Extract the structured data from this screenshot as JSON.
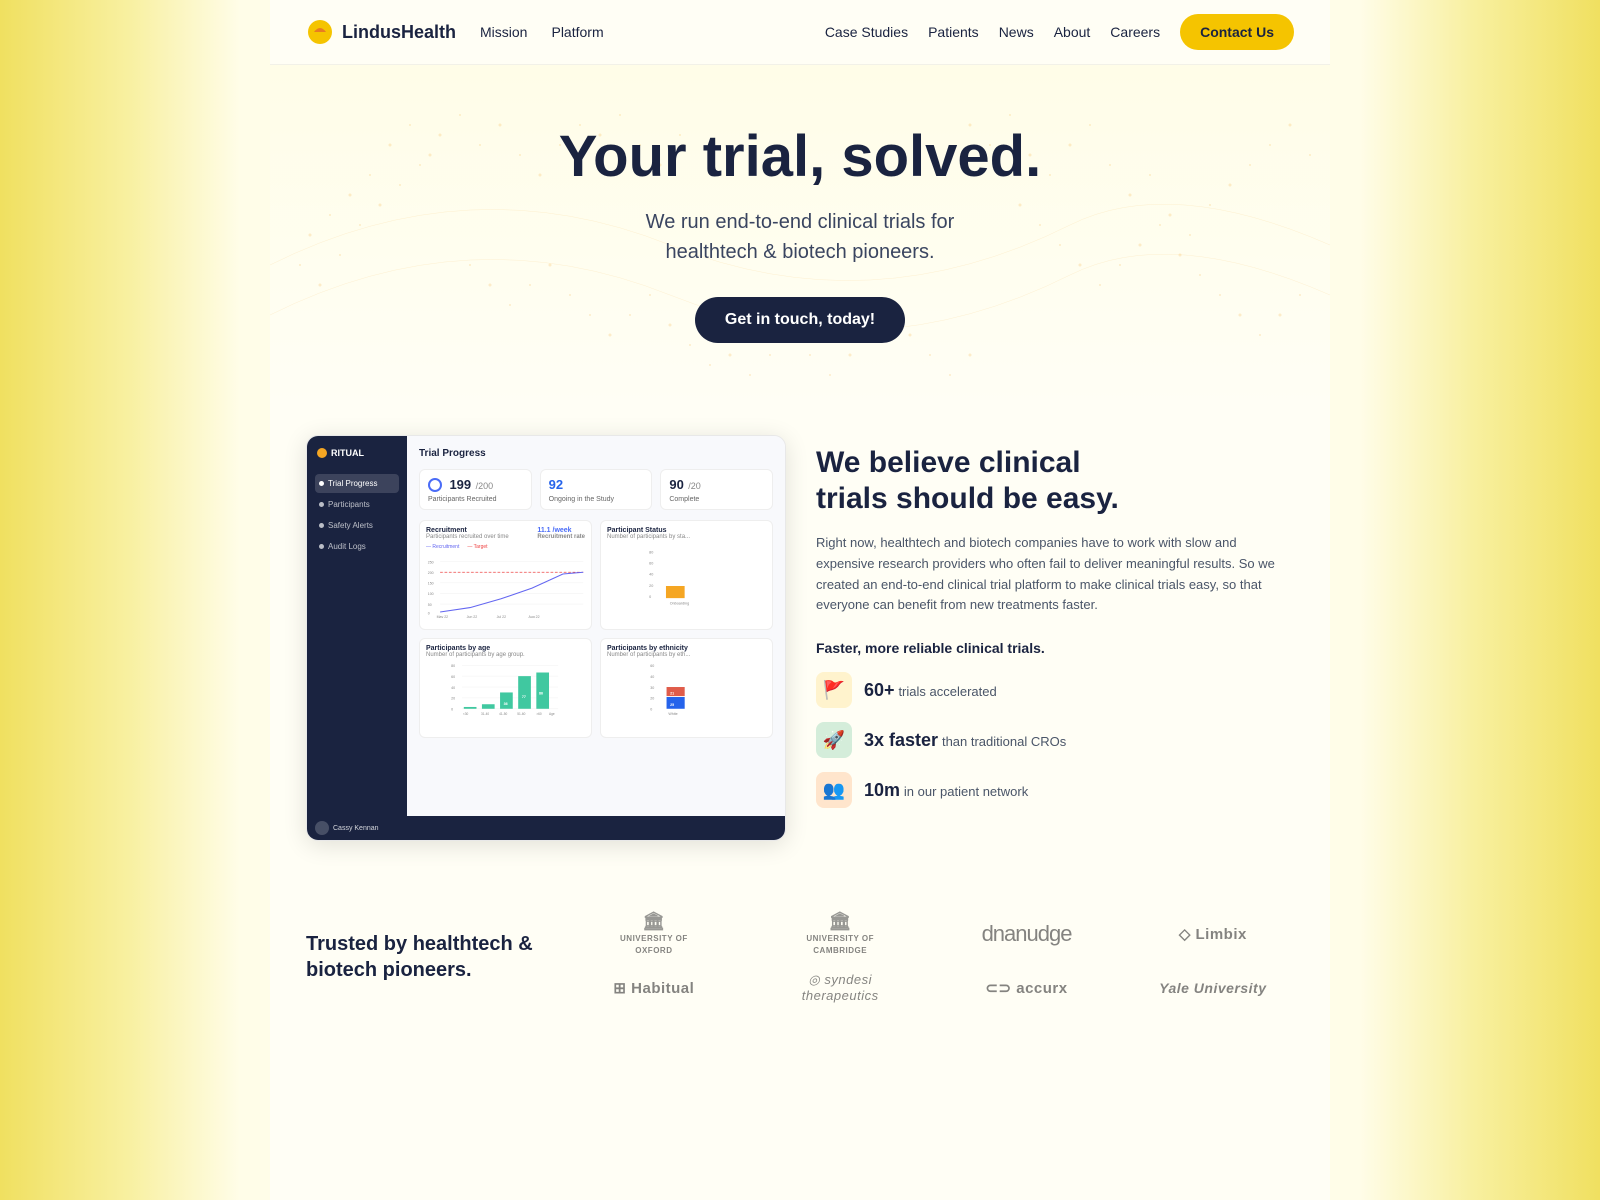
{
  "brand": {
    "name": "LindusHealth",
    "logo_letter": "🟡"
  },
  "nav": {
    "left_items": [
      "Mission",
      "Platform"
    ],
    "right_items": [
      "Case Studies",
      "Patients",
      "News",
      "About",
      "Careers"
    ],
    "cta_label": "Contact Us"
  },
  "hero": {
    "headline": "Your trial, solved.",
    "subtext": "We run end-to-end clinical trials for\nhealthtech & biotech pioneers.",
    "cta_label": "Get in touch, today!"
  },
  "dashboard": {
    "brand": "RITUAL",
    "title": "Trial Progress",
    "nav_items": [
      "Trial Progress",
      "Participants",
      "Safety Alerts",
      "Audit Logs"
    ],
    "stats": [
      {
        "number": "199",
        "denom": "/200",
        "label": "Participants Recruited"
      },
      {
        "number": "92",
        "denom": "",
        "label": "Ongoing in the Study"
      },
      {
        "number": "90",
        "denom": "/20",
        "label": "Complete"
      }
    ],
    "recruitment_title": "Recruitment",
    "recruitment_sub": "Participants recruited over time",
    "recruitment_rate": "11.1 /week",
    "recruitment_rate_label": "Recruitment rate",
    "participant_status_title": "Participant Status",
    "participant_status_sub": "Number of participants by sta...",
    "age_title": "Participants by age",
    "age_sub": "Number of participants by age group.",
    "ethnicity_title": "Participants by ethnicity",
    "ethnicity_sub": "Number of participants by eth...",
    "footer_user": "Cassy Kennan"
  },
  "belief_section": {
    "heading": "We believe clinical\ntrials should be easy.",
    "body": "Right now, healthtech and biotech companies have to work with slow and expensive research providers who often fail to deliver meaningful results. So we created an end-to-end clinical trial platform to make clinical trials easy, so that everyone can benefit from new treatments faster.",
    "faster_title": "Faster, more reliable clinical trials.",
    "stats": [
      {
        "value": "60+",
        "suffix": "trials accelerated",
        "icon": "🚩",
        "color": "yellow"
      },
      {
        "value": "3x faster",
        "suffix": "than traditional CROs",
        "icon": "🚀",
        "color": "green"
      },
      {
        "value": "10m",
        "suffix": "in our patient network",
        "icon": "👥",
        "color": "orange"
      }
    ]
  },
  "trusted": {
    "title": "Trusted by healthtech &\nbiotech pioneers.",
    "logos": [
      {
        "name": "University of Oxford",
        "short": "UNIVERSITY OF\nOXFORD",
        "icon": "🏛"
      },
      {
        "name": "University of Cambridge",
        "short": "UNIVERSITY OF\nCAMBRIDGE",
        "icon": "🏛"
      },
      {
        "name": "dnanudge",
        "short": "dnanudge",
        "icon": "🧬"
      },
      {
        "name": "Limbix",
        "short": "◇ Limbix",
        "icon": ""
      },
      {
        "name": "Habitual",
        "short": "Habitual",
        "icon": "⊞"
      },
      {
        "name": "Syndesi Therapeutics",
        "short": "syndesi\ntherapeutics",
        "icon": "◎"
      },
      {
        "name": "accurx",
        "short": "⊂⊃ accurx",
        "icon": ""
      },
      {
        "name": "Yale University",
        "short": "Yale University",
        "icon": ""
      }
    ]
  }
}
